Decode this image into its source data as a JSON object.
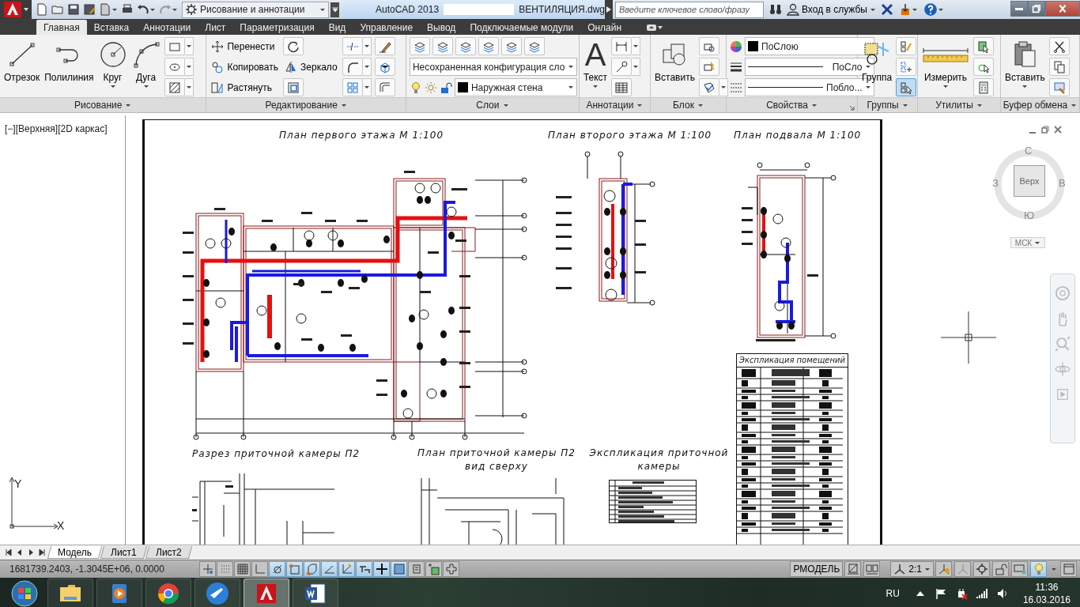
{
  "title_bar": {
    "workspace": "Рисование и аннотации",
    "app_name": "AutoCAD 2013",
    "file_name": "ВЕНТИЛЯЦИЯ.dwg",
    "search_placeholder": "Введите ключевое слово/фразу",
    "sign_in": "Вход в службы"
  },
  "ribbon_tabs": [
    {
      "label": "Главная",
      "selected": true
    },
    {
      "label": "Вставка",
      "selected": false
    },
    {
      "label": "Аннотации",
      "selected": false
    },
    {
      "label": "Лист",
      "selected": false
    },
    {
      "label": "Параметризация",
      "selected": false
    },
    {
      "label": "Вид",
      "selected": false
    },
    {
      "label": "Управление",
      "selected": false
    },
    {
      "label": "Вывод",
      "selected": false
    },
    {
      "label": "Подключаемые модули",
      "selected": false
    },
    {
      "label": "Онлайн",
      "selected": false
    }
  ],
  "ribbon_panels": [
    {
      "title": "Рисование",
      "items": [
        {
          "label": "Отрезок",
          "dropdown": false
        },
        {
          "label": "Полилиния",
          "dropdown": false
        },
        {
          "label": "Круг",
          "dropdown": true
        },
        {
          "label": "Дуга",
          "dropdown": true
        }
      ]
    },
    {
      "title": "Редактирование",
      "items": [
        {
          "label": "Перенести"
        },
        {
          "label": "Копировать"
        },
        {
          "label": "Растянуть"
        },
        {
          "label": "Зеркало"
        }
      ]
    },
    {
      "title": "Слои",
      "items": [
        {
          "value": "Несохраненная конфигурация сло"
        },
        {
          "value": "Наружная стена"
        }
      ]
    },
    {
      "title": "Аннотации",
      "items": [
        {
          "glyph": "A",
          "label": "Текст",
          "dropdown": true
        }
      ]
    },
    {
      "title": "Блок",
      "items": [
        {
          "label": "Вставить",
          "dropdown": false
        }
      ]
    },
    {
      "title": "Свойства",
      "items": [
        {
          "value": "ПоСлою"
        },
        {
          "value": "ПоСло"
        },
        {
          "value": "Побло..."
        }
      ]
    },
    {
      "title": "Группы",
      "items": [
        {
          "label": "Группа",
          "dropdown": false
        }
      ],
      "toggle_on": true
    },
    {
      "title": "Утилиты",
      "items": [
        {
          "label": "Измерить",
          "dropdown": true
        }
      ]
    },
    {
      "title": "Буфер обмена",
      "items": [
        {
          "label": "Вставить",
          "dropdown": true
        }
      ]
    }
  ],
  "viewport": {
    "label": "[−][Верхняя][2D каркас]",
    "titles": [
      {
        "text": "План первого этажа М 1:100"
      },
      {
        "text": "План второго этажа М 1:100"
      },
      {
        "text": "План подвала М 1:100"
      },
      {
        "text": "Разрез приточной камеры П2"
      },
      {
        "text": "План приточной камеры П2 вид сверху"
      },
      {
        "text": "Экспликация приточной камеры"
      }
    ],
    "table_title": "Экспликация помещений",
    "viewcube": {
      "north": "С",
      "west": "З",
      "east": "В",
      "south": "Ю",
      "face": "Верх",
      "ucs": "МСК"
    },
    "ucs_axes": {
      "y": "Y",
      "x": "X"
    }
  },
  "layout_tabs": [
    {
      "label": "Модель",
      "selected": true
    },
    {
      "label": "Лист1",
      "selected": false
    },
    {
      "label": "Лист2",
      "selected": false
    }
  ],
  "status_bar": {
    "coordinates": "1681739.2403, -1.3045E+06, 0.0000",
    "space": "РМОДЕЛЬ",
    "scale": "2:1",
    "toolbar_lock_on": true,
    "toggles": [
      {
        "on": false
      },
      {
        "on": false
      },
      {
        "on": false
      },
      {
        "on": false
      },
      {
        "on": true
      },
      {
        "on": true
      },
      {
        "on": true
      },
      {
        "on": true
      },
      {
        "on": true
      },
      {
        "on": true
      },
      {
        "on": true
      },
      {
        "on": true
      },
      {
        "on": false
      },
      {
        "on": false
      },
      {
        "on": false
      }
    ]
  },
  "taskbar": {
    "apps": [
      {
        "selected": false
      },
      {
        "selected": false
      },
      {
        "selected": false
      },
      {
        "selected": false
      },
      {
        "selected": true
      },
      {
        "selected": false
      }
    ],
    "language": "RU",
    "time": "11:36",
    "date": "16.03.2016"
  }
}
